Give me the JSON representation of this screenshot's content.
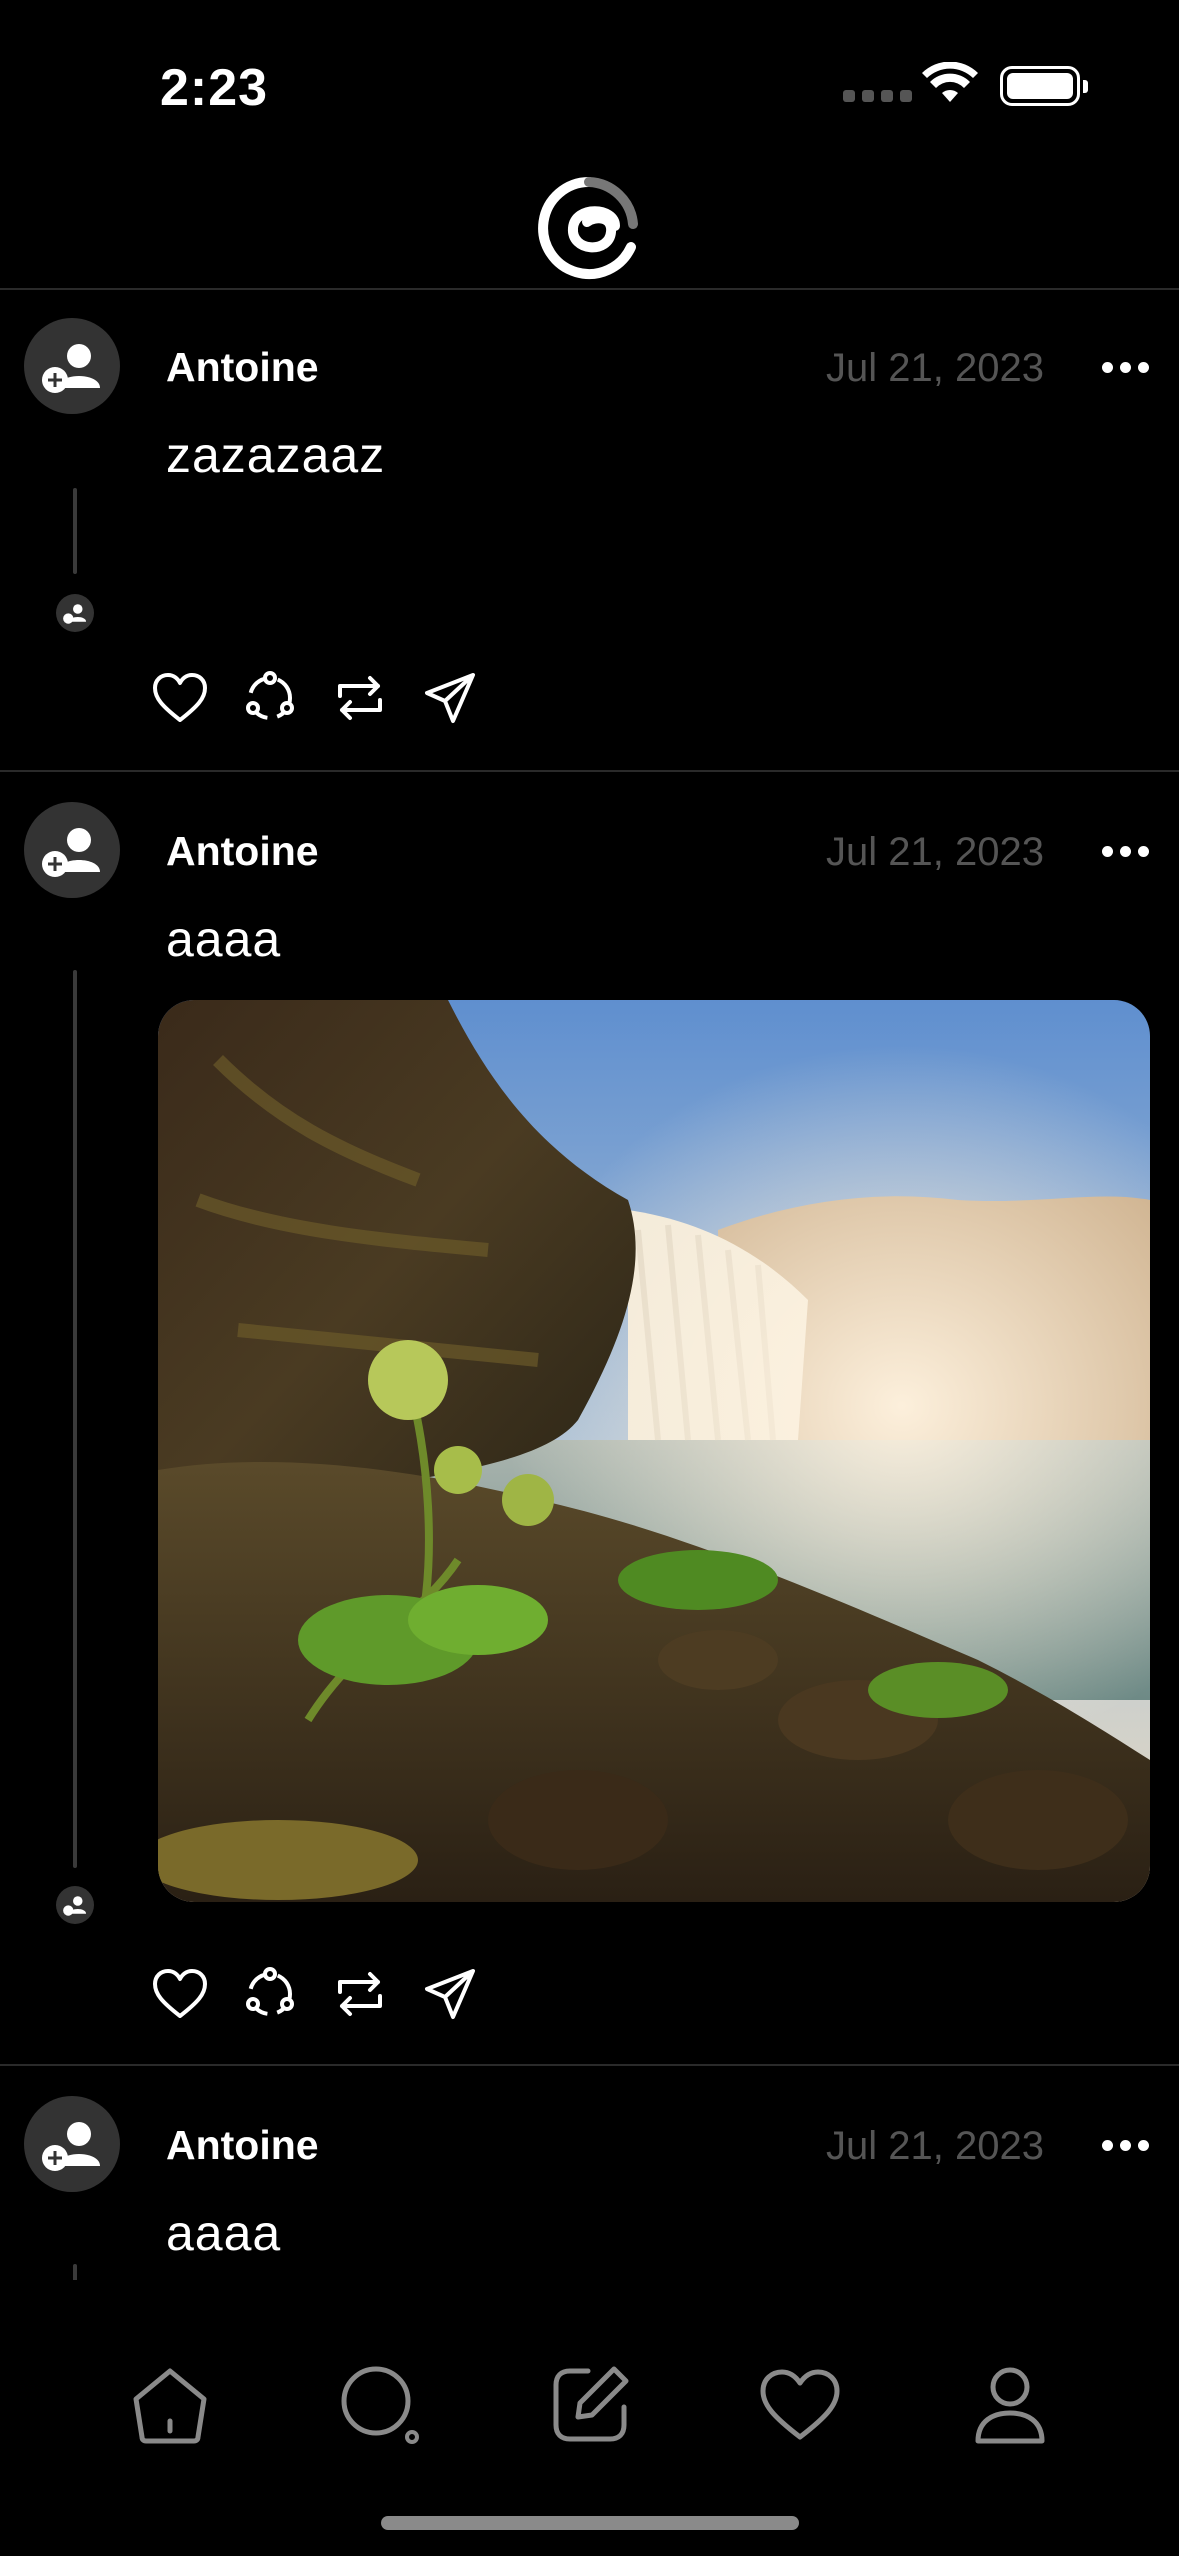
{
  "status": {
    "time": "2:23"
  },
  "feed": {
    "posts": [
      {
        "author": "Antoine",
        "date": "Jul 21, 2023",
        "text": "zazazaaz",
        "has_image": false
      },
      {
        "author": "Antoine",
        "date": "Jul 21, 2023",
        "text": "aaaa",
        "has_image": true,
        "image_description": "waterfall landscape photo"
      },
      {
        "author": "Antoine",
        "date": "Jul 21, 2023",
        "text": "aaaa",
        "has_image": false
      }
    ]
  },
  "icons": {
    "header": "threads-logo-icon",
    "actions": [
      "heart-icon",
      "reply-icon",
      "repost-icon",
      "share-icon"
    ],
    "tabs": [
      "home-icon",
      "search-icon",
      "compose-icon",
      "activity-icon",
      "profile-icon"
    ]
  },
  "colors": {
    "background": "#000000",
    "text": "#ffffff",
    "muted": "#555555",
    "divider": "#2a2a2a"
  }
}
